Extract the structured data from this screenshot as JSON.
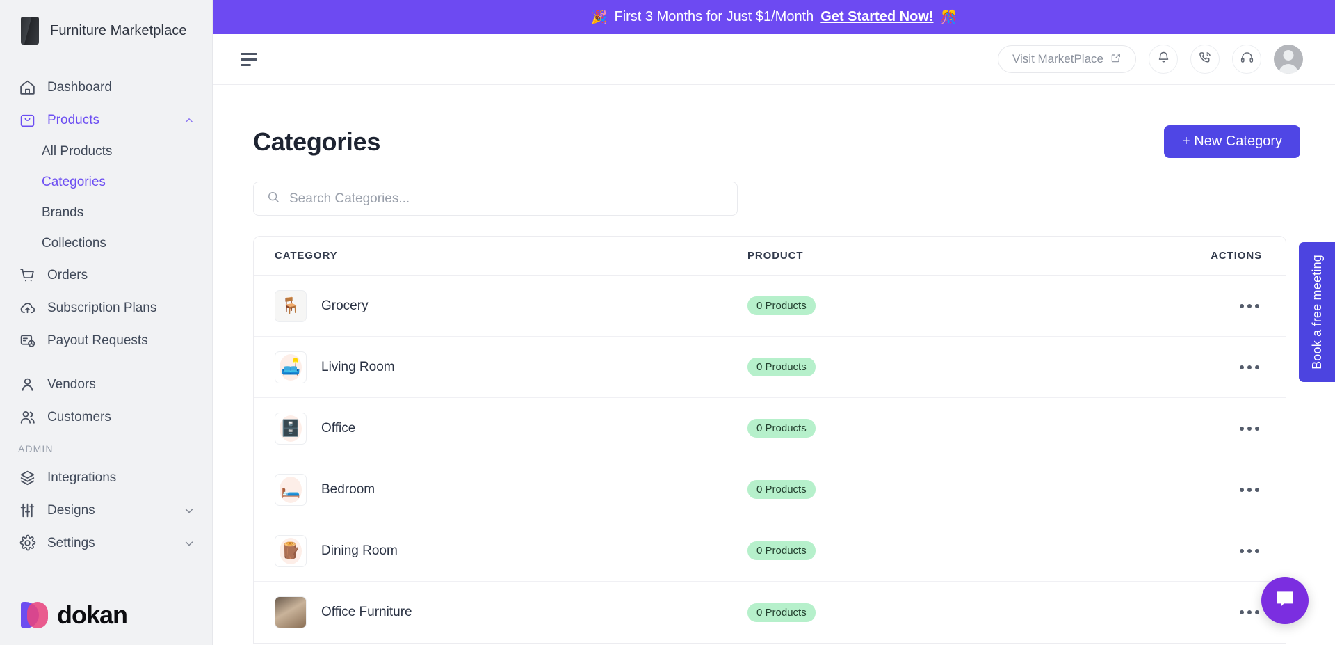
{
  "sidebar": {
    "brand": {
      "name": "Furniture Marketplace",
      "logo_icon": "store-logo-icon"
    },
    "items": [
      {
        "label": "Dashboard",
        "icon": "home-icon"
      },
      {
        "label": "Products",
        "icon": "bag-icon",
        "active": true,
        "expanded": true
      },
      {
        "label": "Orders",
        "icon": "cart-icon"
      },
      {
        "label": "Subscription Plans",
        "icon": "cloud-upload-icon"
      },
      {
        "label": "Payout Requests",
        "icon": "payout-clock-icon"
      },
      {
        "label": "Vendors",
        "icon": "user-icon"
      },
      {
        "label": "Customers",
        "icon": "users-icon"
      }
    ],
    "sub_items": [
      {
        "label": "All Products"
      },
      {
        "label": "Categories",
        "active": true
      },
      {
        "label": "Brands"
      },
      {
        "label": "Collections"
      }
    ],
    "section_label": "ADMIN",
    "admin_items": [
      {
        "label": "Integrations",
        "icon": "layers-icon"
      },
      {
        "label": "Designs",
        "icon": "sliders-icon",
        "chevron": true
      },
      {
        "label": "Settings",
        "icon": "gear-icon",
        "chevron": true
      }
    ],
    "footer_logo_text": "dokan"
  },
  "promo": {
    "emoji_left": "🎉",
    "text": "First 3 Months for Just $1/Month",
    "cta": "Get Started Now!",
    "emoji_right": "🎊",
    "bg_color": "#6d4af2"
  },
  "topbar": {
    "menu_icon": "hamburger-icon",
    "visit_label": "Visit MarketPlace",
    "external_icon": "external-link-icon",
    "notification_icon": "bell-icon",
    "call_icon": "phone-call-icon",
    "support_icon": "headset-icon",
    "avatar_icon": "user-avatar"
  },
  "page": {
    "title": "Categories",
    "new_button": "+  New Category",
    "accent_color": "#4f46e5"
  },
  "search": {
    "placeholder": "Search Categories...",
    "value": "",
    "icon": "search-icon"
  },
  "table": {
    "columns": [
      "CATEGORY",
      "PRODUCT",
      "ACTIONS"
    ],
    "rows": [
      {
        "category": "Grocery",
        "product": "0 Products",
        "thumb": "chair-photo",
        "actions_icon": "more-horizontal-icon"
      },
      {
        "category": "Living Room",
        "product": "0 Products",
        "thumb": "sofa-icon",
        "actions_icon": "more-horizontal-icon"
      },
      {
        "category": "Office",
        "product": "0 Products",
        "thumb": "desk-icon",
        "actions_icon": "more-horizontal-icon"
      },
      {
        "category": "Bedroom",
        "product": "0 Products",
        "thumb": "bed-icon",
        "actions_icon": "more-horizontal-icon"
      },
      {
        "category": "Dining Room",
        "product": "0 Products",
        "thumb": "table-icon",
        "actions_icon": "more-horizontal-icon"
      },
      {
        "category": "Office Furniture",
        "product": "0 Products",
        "thumb": "office-photo",
        "actions_icon": "more-horizontal-icon"
      }
    ],
    "badge_bg": "#b6f0cb"
  },
  "widgets": {
    "book_meeting": "Book a free meeting",
    "book_meeting_color": "#4c44e0",
    "chat_icon": "chat-bubble-icon",
    "chat_color": "#7b2ee0"
  }
}
